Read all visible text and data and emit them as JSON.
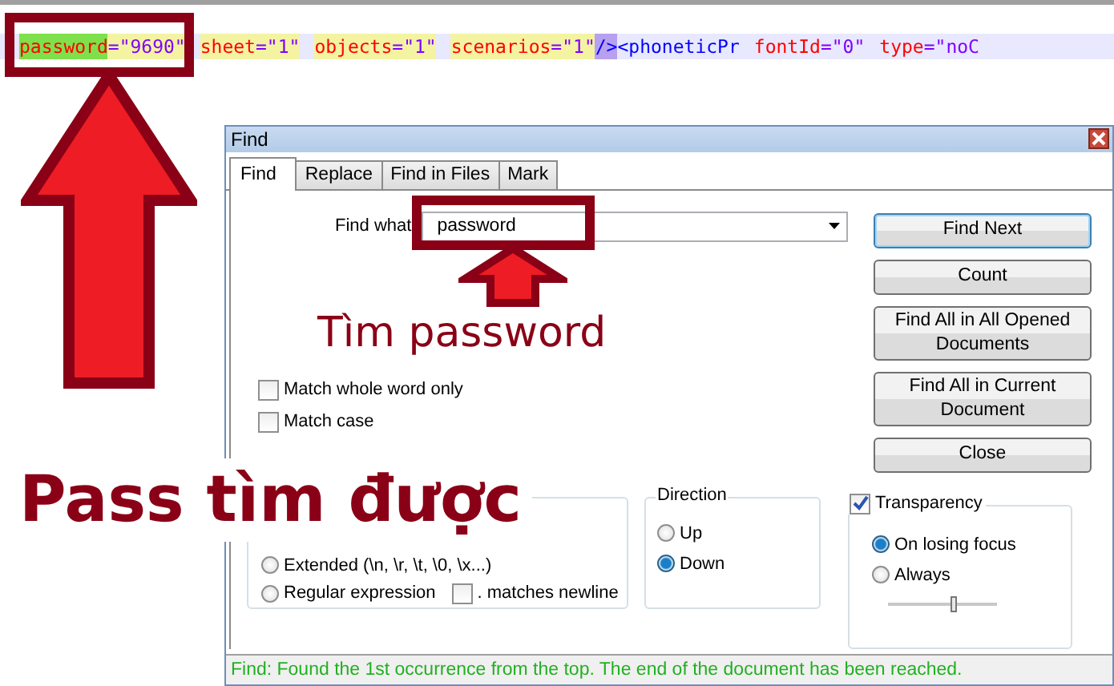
{
  "editor": {
    "words": [
      {
        "parts": [
          {
            "text": "password",
            "kind": "attr",
            "color": "#7ee04a"
          },
          {
            "text": "=\"9690\"",
            "kind": "value",
            "color": "#f4f3a2"
          }
        ]
      },
      {
        "parts": [
          {
            "text": "sheet",
            "kind": "attr",
            "color": "#f4f3a2"
          },
          {
            "text": "=\"1\"",
            "kind": "value",
            "color": "#f4f3a2"
          }
        ]
      },
      {
        "parts": [
          {
            "text": "objects",
            "kind": "attr",
            "color": "#f4f3a2"
          },
          {
            "text": "=\"1\"",
            "kind": "value",
            "color": "#f4f3a2"
          }
        ]
      },
      {
        "parts": [
          {
            "text": "scenarios",
            "kind": "attr",
            "color": "#f4f3a2"
          },
          {
            "text": "=\"1\"",
            "kind": "value",
            "color": "#f4f3a2"
          },
          {
            "text": "/>",
            "kind": "tag",
            "color": "#b8a0f0"
          },
          {
            "text": "<phoneticPr",
            "kind": "tag"
          }
        ]
      },
      {
        "parts": [
          {
            "text": "fontId",
            "kind": "attr"
          },
          {
            "text": "=\"0\"",
            "kind": "value"
          }
        ]
      },
      {
        "parts": [
          {
            "text": "type",
            "kind": "attr"
          },
          {
            "text": "=\"noC",
            "kind": "value"
          }
        ]
      }
    ]
  },
  "dialog": {
    "title": "Find",
    "tabs": [
      {
        "label": "Find",
        "selected": true
      },
      {
        "label": "Replace",
        "selected": false
      },
      {
        "label": "Find in Files",
        "selected": false
      },
      {
        "label": "Mark",
        "selected": false
      }
    ],
    "find_what": {
      "label": "Find what",
      "value": "password"
    },
    "options": [
      {
        "label": "Match whole word only",
        "checked": false
      },
      {
        "label": "Match case",
        "checked": false
      }
    ],
    "search_mode": {
      "radios": [
        {
          "label": "Extended (\\n, \\r, \\t, \\0, \\x...)",
          "selected": false
        },
        {
          "label": "Regular expression",
          "selected": false
        }
      ],
      "matches_newline": {
        "label": ". matches newline",
        "checked": false
      }
    },
    "direction": {
      "title": "Direction",
      "radios": [
        {
          "label": "Up",
          "selected": false
        },
        {
          "label": "Down",
          "selected": true
        }
      ]
    },
    "transparency": {
      "label": "Transparency",
      "checked": true,
      "radios": [
        {
          "label": "On losing focus",
          "selected": true
        },
        {
          "label": "Always",
          "selected": false
        }
      ],
      "level": 0.6
    },
    "buttons": [
      {
        "label": "Find Next",
        "default": true
      },
      {
        "label": "Count",
        "default": false
      },
      {
        "label": "Find All in All Opened Documents",
        "default": false
      },
      {
        "label": "Find All in Current Document",
        "default": false
      },
      {
        "label": "Close",
        "default": false
      }
    ],
    "status": "Find: Found the 1st occurrence from the top. The end of the document has been reached."
  },
  "annotations": {
    "caption_small": "Tìm password",
    "caption_large": "Pass tìm được"
  }
}
